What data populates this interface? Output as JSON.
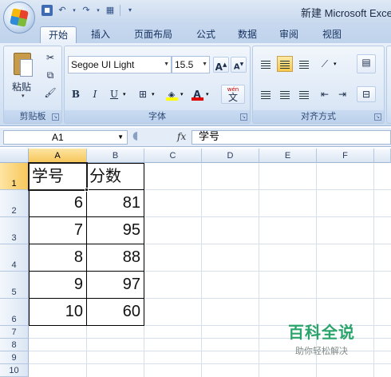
{
  "window": {
    "title": "新建 Microsoft Excel"
  },
  "ribbon_tabs": [
    "开始",
    "插入",
    "页面布局",
    "公式",
    "数据",
    "审阅",
    "视图"
  ],
  "clipboard": {
    "paste_label": "粘贴",
    "group_label": "剪贴板"
  },
  "font": {
    "family": "Segoe UI Light",
    "size": "15.5",
    "group_label": "字体",
    "bold": "B",
    "italic": "I",
    "underline": "U",
    "grow": "A",
    "shrink": "A",
    "phonetic_top": "wén",
    "phonetic_bottom": "文",
    "font_color_glyph": "A"
  },
  "alignment": {
    "group_label": "对齐方式"
  },
  "formula_bar": {
    "name_box": "A1",
    "fx": "fx",
    "content": "学号"
  },
  "columns": [
    "A",
    "B",
    "C",
    "D",
    "E",
    "F"
  ],
  "rows": [
    "1",
    "2",
    "3",
    "4",
    "5",
    "6",
    "7",
    "8",
    "9",
    "10"
  ],
  "table": {
    "headers": [
      "学号",
      "分数"
    ],
    "rows": [
      [
        "6",
        "81"
      ],
      [
        "7",
        "95"
      ],
      [
        "8",
        "88"
      ],
      [
        "9",
        "97"
      ],
      [
        "10",
        "60"
      ]
    ]
  },
  "watermark": {
    "title": "百科全说",
    "subtitle": "助你轻松解决"
  },
  "colors": {
    "accent": "#2aa46a",
    "selection": "#f7c75a",
    "ribbon": "#dbe7f6"
  }
}
